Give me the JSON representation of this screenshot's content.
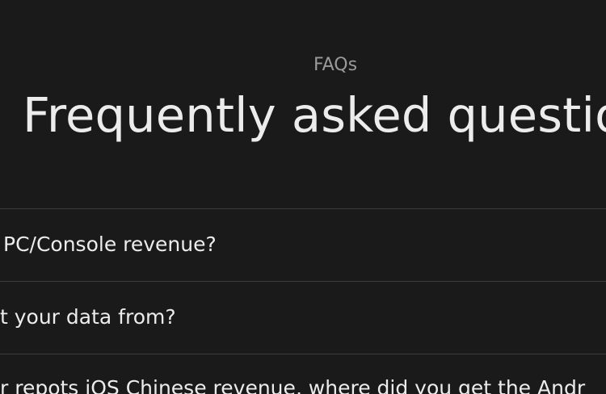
{
  "header": {
    "eyebrow": "FAQs",
    "title": "Frequently asked questio"
  },
  "faq": {
    "items": [
      {
        "question": "PC/Console revenue?"
      },
      {
        "question": "t your data from?"
      },
      {
        "question": "r repots iOS Chinese revenue, where did you get the Andr"
      }
    ]
  }
}
